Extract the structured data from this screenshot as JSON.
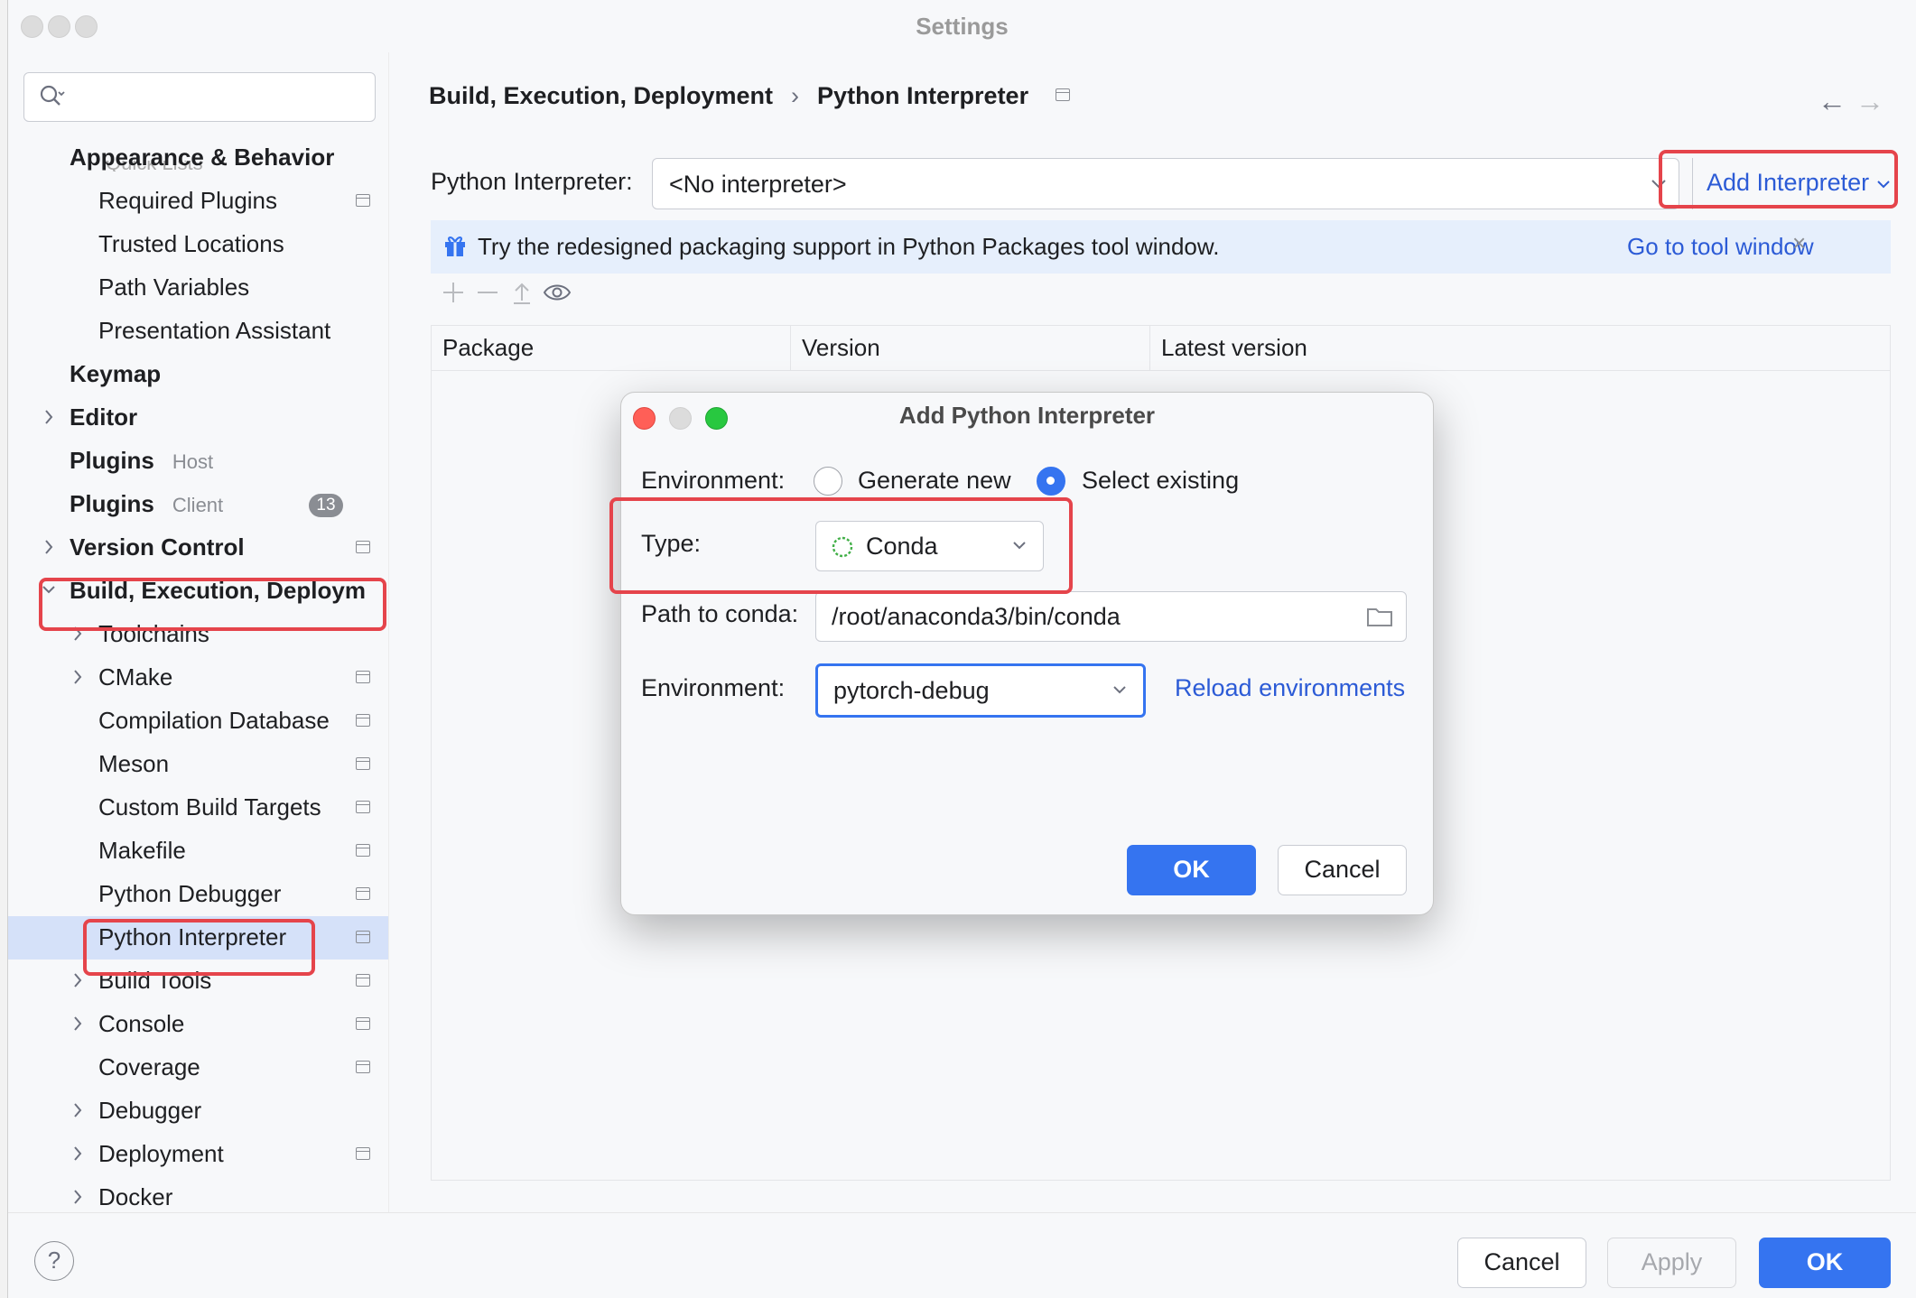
{
  "window": {
    "title": "Settings"
  },
  "search": {
    "placeholder": ""
  },
  "sidebar": {
    "items": [
      {
        "label": "Appearance & Behavior",
        "bold": true,
        "indent": 0,
        "chevron": false,
        "pin": false
      },
      {
        "label": "Required Plugins",
        "bold": false,
        "indent": 1,
        "chevron": false,
        "pin": true
      },
      {
        "label": "Trusted Locations",
        "bold": false,
        "indent": 1,
        "chevron": false,
        "pin": false
      },
      {
        "label": "Path Variables",
        "bold": false,
        "indent": 1,
        "chevron": false,
        "pin": false
      },
      {
        "label": "Presentation Assistant",
        "bold": false,
        "indent": 1,
        "chevron": false,
        "pin": false
      },
      {
        "label": "Keymap",
        "bold": true,
        "indent": 0,
        "chevron": false,
        "pin": false
      },
      {
        "label": "Editor",
        "bold": true,
        "indent": 0,
        "chevron": true,
        "pin": false
      },
      {
        "label": "Plugins",
        "sub": "Host",
        "bold": true,
        "indent": 0,
        "chevron": false,
        "pin": false
      },
      {
        "label": "Plugins",
        "sub": "Client",
        "badge": "13",
        "bold": true,
        "indent": 0,
        "chevron": false,
        "pin": false
      },
      {
        "label": "Version Control",
        "bold": true,
        "indent": 0,
        "chevron": true,
        "pin": true
      },
      {
        "label": "Build, Execution, Deploym",
        "bold": true,
        "indent": 0,
        "chevron": true,
        "expanded": true,
        "pin": false
      },
      {
        "label": "Toolchains",
        "bold": false,
        "indent": 1,
        "chevron": true,
        "pin": false
      },
      {
        "label": "CMake",
        "bold": false,
        "indent": 1,
        "chevron": true,
        "pin": true
      },
      {
        "label": "Compilation Database",
        "bold": false,
        "indent": 1,
        "chevron": false,
        "pin": true
      },
      {
        "label": "Meson",
        "bold": false,
        "indent": 1,
        "chevron": false,
        "pin": true
      },
      {
        "label": "Custom Build Targets",
        "bold": false,
        "indent": 1,
        "chevron": false,
        "pin": true
      },
      {
        "label": "Makefile",
        "bold": false,
        "indent": 1,
        "chevron": false,
        "pin": true
      },
      {
        "label": "Python Debugger",
        "bold": false,
        "indent": 1,
        "chevron": false,
        "pin": true
      },
      {
        "label": "Python Interpreter",
        "bold": false,
        "indent": 1,
        "chevron": false,
        "pin": true,
        "selected": true
      },
      {
        "label": "Build Tools",
        "bold": false,
        "indent": 1,
        "chevron": true,
        "pin": true
      },
      {
        "label": "Console",
        "bold": false,
        "indent": 1,
        "chevron": true,
        "pin": true
      },
      {
        "label": "Coverage",
        "bold": false,
        "indent": 1,
        "chevron": false,
        "pin": true
      },
      {
        "label": "Debugger",
        "bold": false,
        "indent": 1,
        "chevron": true,
        "pin": false
      },
      {
        "label": "Deployment",
        "bold": false,
        "indent": 1,
        "chevron": true,
        "pin": true
      },
      {
        "label": "Docker",
        "bold": false,
        "indent": 1,
        "chevron": true,
        "pin": false
      }
    ]
  },
  "breadcrumb": {
    "parent": "Build, Execution, Deployment",
    "separator": "›",
    "current": "Python Interpreter"
  },
  "nav": {
    "back": "←",
    "forward": "→"
  },
  "interpreter": {
    "label": "Python Interpreter:",
    "value": "<No interpreter>",
    "add_label": "Add Interpreter"
  },
  "banner": {
    "text": "Try the redesigned packaging support in Python Packages tool window.",
    "link": "Go to tool window",
    "close": "×"
  },
  "table": {
    "columns": [
      "Package",
      "Version",
      "Latest version"
    ]
  },
  "footer": {
    "help": "?",
    "cancel": "Cancel",
    "apply": "Apply",
    "ok": "OK"
  },
  "dialog": {
    "title": "Add Python Interpreter",
    "environment_label": "Environment:",
    "radio_generate": "Generate new",
    "radio_select": "Select existing",
    "type_label": "Type:",
    "type_value": "Conda",
    "path_label": "Path to conda:",
    "path_value": "/root/anaconda3/bin/conda",
    "env_label": "Environment:",
    "env_value": "pytorch-debug",
    "reload_link": "Reload environments",
    "ok": "OK",
    "cancel": "Cancel"
  },
  "colors": {
    "accent": "#3574f0",
    "link": "#2c5bd6",
    "highlight": "#e5444b",
    "selection": "#d5e1f9",
    "banner": "#e6effc"
  }
}
